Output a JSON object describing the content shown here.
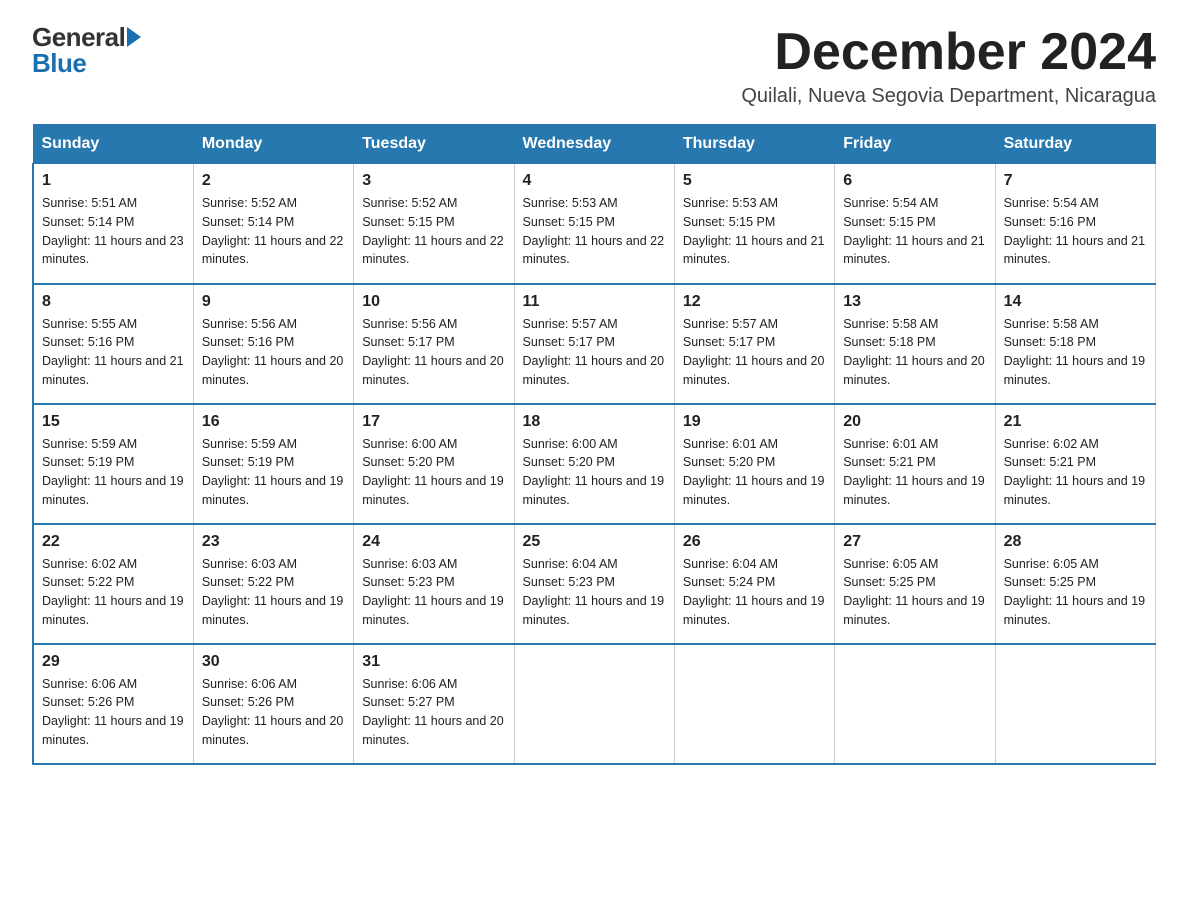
{
  "logo": {
    "general": "General",
    "arrow": "▶",
    "blue": "Blue"
  },
  "title": "December 2024",
  "subtitle": "Quilali, Nueva Segovia Department, Nicaragua",
  "weekdays": [
    "Sunday",
    "Monday",
    "Tuesday",
    "Wednesday",
    "Thursday",
    "Friday",
    "Saturday"
  ],
  "weeks": [
    [
      {
        "day": "1",
        "sunrise": "5:51 AM",
        "sunset": "5:14 PM",
        "daylight": "11 hours and 23 minutes."
      },
      {
        "day": "2",
        "sunrise": "5:52 AM",
        "sunset": "5:14 PM",
        "daylight": "11 hours and 22 minutes."
      },
      {
        "day": "3",
        "sunrise": "5:52 AM",
        "sunset": "5:15 PM",
        "daylight": "11 hours and 22 minutes."
      },
      {
        "day": "4",
        "sunrise": "5:53 AM",
        "sunset": "5:15 PM",
        "daylight": "11 hours and 22 minutes."
      },
      {
        "day": "5",
        "sunrise": "5:53 AM",
        "sunset": "5:15 PM",
        "daylight": "11 hours and 21 minutes."
      },
      {
        "day": "6",
        "sunrise": "5:54 AM",
        "sunset": "5:15 PM",
        "daylight": "11 hours and 21 minutes."
      },
      {
        "day": "7",
        "sunrise": "5:54 AM",
        "sunset": "5:16 PM",
        "daylight": "11 hours and 21 minutes."
      }
    ],
    [
      {
        "day": "8",
        "sunrise": "5:55 AM",
        "sunset": "5:16 PM",
        "daylight": "11 hours and 21 minutes."
      },
      {
        "day": "9",
        "sunrise": "5:56 AM",
        "sunset": "5:16 PM",
        "daylight": "11 hours and 20 minutes."
      },
      {
        "day": "10",
        "sunrise": "5:56 AM",
        "sunset": "5:17 PM",
        "daylight": "11 hours and 20 minutes."
      },
      {
        "day": "11",
        "sunrise": "5:57 AM",
        "sunset": "5:17 PM",
        "daylight": "11 hours and 20 minutes."
      },
      {
        "day": "12",
        "sunrise": "5:57 AM",
        "sunset": "5:17 PM",
        "daylight": "11 hours and 20 minutes."
      },
      {
        "day": "13",
        "sunrise": "5:58 AM",
        "sunset": "5:18 PM",
        "daylight": "11 hours and 20 minutes."
      },
      {
        "day": "14",
        "sunrise": "5:58 AM",
        "sunset": "5:18 PM",
        "daylight": "11 hours and 19 minutes."
      }
    ],
    [
      {
        "day": "15",
        "sunrise": "5:59 AM",
        "sunset": "5:19 PM",
        "daylight": "11 hours and 19 minutes."
      },
      {
        "day": "16",
        "sunrise": "5:59 AM",
        "sunset": "5:19 PM",
        "daylight": "11 hours and 19 minutes."
      },
      {
        "day": "17",
        "sunrise": "6:00 AM",
        "sunset": "5:20 PM",
        "daylight": "11 hours and 19 minutes."
      },
      {
        "day": "18",
        "sunrise": "6:00 AM",
        "sunset": "5:20 PM",
        "daylight": "11 hours and 19 minutes."
      },
      {
        "day": "19",
        "sunrise": "6:01 AM",
        "sunset": "5:20 PM",
        "daylight": "11 hours and 19 minutes."
      },
      {
        "day": "20",
        "sunrise": "6:01 AM",
        "sunset": "5:21 PM",
        "daylight": "11 hours and 19 minutes."
      },
      {
        "day": "21",
        "sunrise": "6:02 AM",
        "sunset": "5:21 PM",
        "daylight": "11 hours and 19 minutes."
      }
    ],
    [
      {
        "day": "22",
        "sunrise": "6:02 AM",
        "sunset": "5:22 PM",
        "daylight": "11 hours and 19 minutes."
      },
      {
        "day": "23",
        "sunrise": "6:03 AM",
        "sunset": "5:22 PM",
        "daylight": "11 hours and 19 minutes."
      },
      {
        "day": "24",
        "sunrise": "6:03 AM",
        "sunset": "5:23 PM",
        "daylight": "11 hours and 19 minutes."
      },
      {
        "day": "25",
        "sunrise": "6:04 AM",
        "sunset": "5:23 PM",
        "daylight": "11 hours and 19 minutes."
      },
      {
        "day": "26",
        "sunrise": "6:04 AM",
        "sunset": "5:24 PM",
        "daylight": "11 hours and 19 minutes."
      },
      {
        "day": "27",
        "sunrise": "6:05 AM",
        "sunset": "5:25 PM",
        "daylight": "11 hours and 19 minutes."
      },
      {
        "day": "28",
        "sunrise": "6:05 AM",
        "sunset": "5:25 PM",
        "daylight": "11 hours and 19 minutes."
      }
    ],
    [
      {
        "day": "29",
        "sunrise": "6:06 AM",
        "sunset": "5:26 PM",
        "daylight": "11 hours and 19 minutes."
      },
      {
        "day": "30",
        "sunrise": "6:06 AM",
        "sunset": "5:26 PM",
        "daylight": "11 hours and 20 minutes."
      },
      {
        "day": "31",
        "sunrise": "6:06 AM",
        "sunset": "5:27 PM",
        "daylight": "11 hours and 20 minutes."
      },
      null,
      null,
      null,
      null
    ]
  ],
  "labels": {
    "sunrise_prefix": "Sunrise: ",
    "sunset_prefix": "Sunset: ",
    "daylight_prefix": "Daylight: "
  }
}
